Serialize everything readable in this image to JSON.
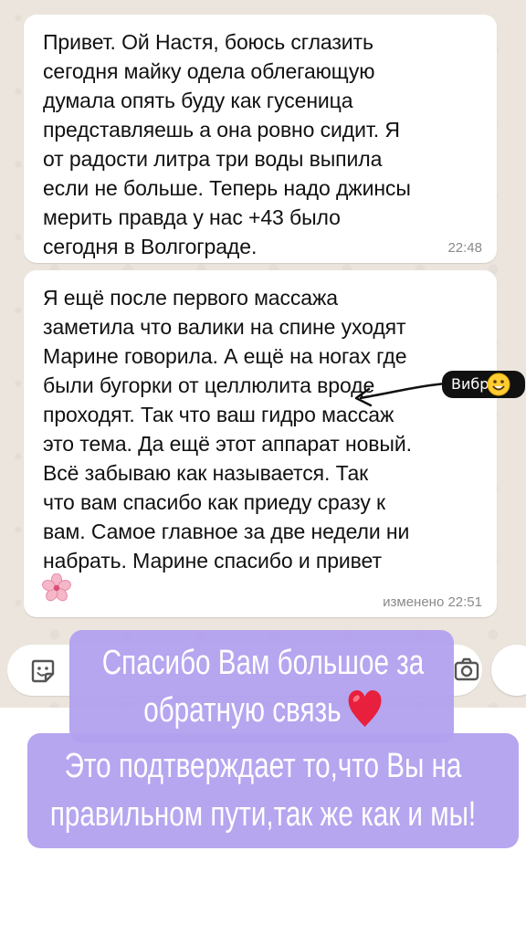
{
  "chat": {
    "messages": [
      {
        "text": "Привет. Ой Настя, боюсь сглазить\nсегодня майку одела облегающую\nдумала опять буду как гусеница\nпредставляешь а она ровно сидит. Я\nот радости литра три воды выпила\nесли не больше. Теперь надо джинсы\nмерить правда у нас +43 было\nсегодня в Волгограде.",
        "time": "22:48"
      },
      {
        "text": "Я ещё после первого массажа\nзаметила что валики на спине уходят\nМарине говорила. А ещё на ногах где\nбыли бугорки от целлюлита вроде\nпроходят. Так что ваш гидро массаж\nэто тема. Да ещё этот аппарат новый.\nВсё забываю как называется.  Так\nчто вам спасибо как приеду сразу к\nвам. Самое главное за две недели ни\nнабрать. Марине спасибо и привет",
        "time": "изменено 22:51",
        "emoji_icon": "cherry-blossom-icon"
      }
    ]
  },
  "annotation": {
    "label": "Вибро",
    "emoji_icon": "smiley-icon"
  },
  "input_bar": {
    "emoji_icon": "sticker-icon",
    "camera_icon": "camera-icon",
    "mic_icon": "mic-icon"
  },
  "overlay": {
    "line1": "Спасибо Вам большое за",
    "line2": "обратную связь",
    "heart_icon": "red-heart-icon",
    "line3": "Это подтверждает то,что Вы на",
    "line4": "правильном пути,так же как и мы!",
    "color": "#b2a0ee"
  }
}
